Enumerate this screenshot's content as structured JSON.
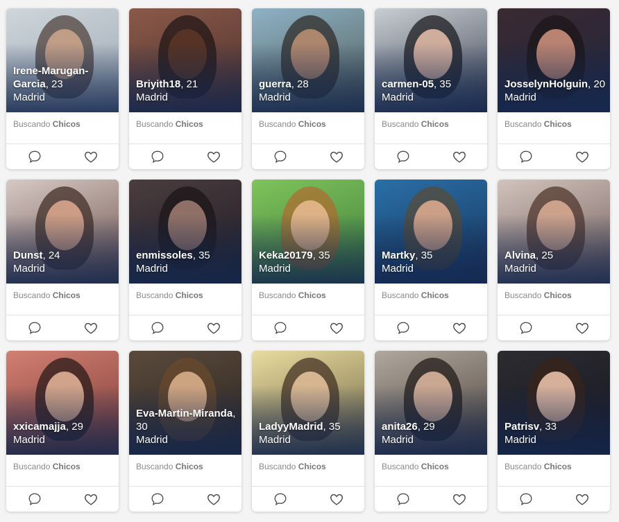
{
  "seeking_prefix": "Buscando",
  "seeking_target": "Chicos",
  "profiles": [
    {
      "name": "Irene-Marugan-Garcia",
      "age": "23",
      "city": "Madrid",
      "bg": [
        "#cfd6dc",
        "#9aa6b0"
      ],
      "skin": "#caa38a",
      "hair": "#4a3a34"
    },
    {
      "name": "Briyith18",
      "age": "21",
      "city": "Madrid",
      "bg": [
        "#8a5a4a",
        "#4b2e2a"
      ],
      "skin": "#5a3526",
      "hair": "#1d1312"
    },
    {
      "name": "guerra",
      "age": "28",
      "city": "Madrid",
      "bg": [
        "#8fb2c7",
        "#4d5a52"
      ],
      "skin": "#b98d72",
      "hair": "#2b2521"
    },
    {
      "name": "carmen-05",
      "age": "35",
      "city": "Madrid",
      "bg": [
        "#c9ced3",
        "#3a4150"
      ],
      "skin": "#e0b9a6",
      "hair": "#141418"
    },
    {
      "name": "JosselynHolguin",
      "age": "20",
      "city": "Madrid",
      "bg": [
        "#3b2a30",
        "#1d2540"
      ],
      "skin": "#c98f7a",
      "hair": "#1a1416"
    },
    {
      "name": "Dunst",
      "age": "24",
      "city": "Madrid",
      "bg": [
        "#d6c9c4",
        "#6b4f49"
      ],
      "skin": "#d8a58c",
      "hair": "#3a2620"
    },
    {
      "name": "enmissoles",
      "age": "35",
      "city": "Madrid",
      "bg": [
        "#4a3d3f",
        "#1f1b24"
      ],
      "skin": "#9c7a6e",
      "hair": "#1a1416"
    },
    {
      "name": "Keka20179",
      "age": "35",
      "city": "Madrid",
      "bg": [
        "#7fc45c",
        "#3d7a3a"
      ],
      "skin": "#e7b88f",
      "hair": "#b06a2f"
    },
    {
      "name": "Martky",
      "age": "35",
      "city": "Madrid",
      "bg": [
        "#2a6fa8",
        "#163458"
      ],
      "skin": "#d9a88e",
      "hair": "#5a4a32"
    },
    {
      "name": "Alvina",
      "age": "25",
      "city": "Madrid",
      "bg": [
        "#d2c3bd",
        "#6e5a56"
      ],
      "skin": "#d7ab94",
      "hair": "#4a2f25"
    },
    {
      "name": "xxicamajja",
      "age": "29",
      "city": "Madrid",
      "bg": [
        "#d27f72",
        "#7a3a34"
      ],
      "skin": "#e0b095",
      "hair": "#1f1412"
    },
    {
      "name": "Eva-Martin-Miranda",
      "age": "30",
      "city": "Madrid",
      "bg": [
        "#5a4a3c",
        "#2a2420"
      ],
      "skin": "#d9ae8a",
      "hair": "#6b4a2c"
    },
    {
      "name": "LadyyMadrid",
      "age": "35",
      "city": "Madrid",
      "bg": [
        "#e9dca0",
        "#6a6040"
      ],
      "skin": "#e3c19a",
      "hair": "#3a2a1e"
    },
    {
      "name": "anita26",
      "age": "29",
      "city": "Madrid",
      "bg": [
        "#b0a89e",
        "#4a3e36"
      ],
      "skin": "#d9b49c",
      "hair": "#1a1414"
    },
    {
      "name": "Patrisv",
      "age": "33",
      "city": "Madrid",
      "bg": [
        "#2c2c30",
        "#151520"
      ],
      "skin": "#e8c0aa",
      "hair": "#3a2418"
    }
  ]
}
